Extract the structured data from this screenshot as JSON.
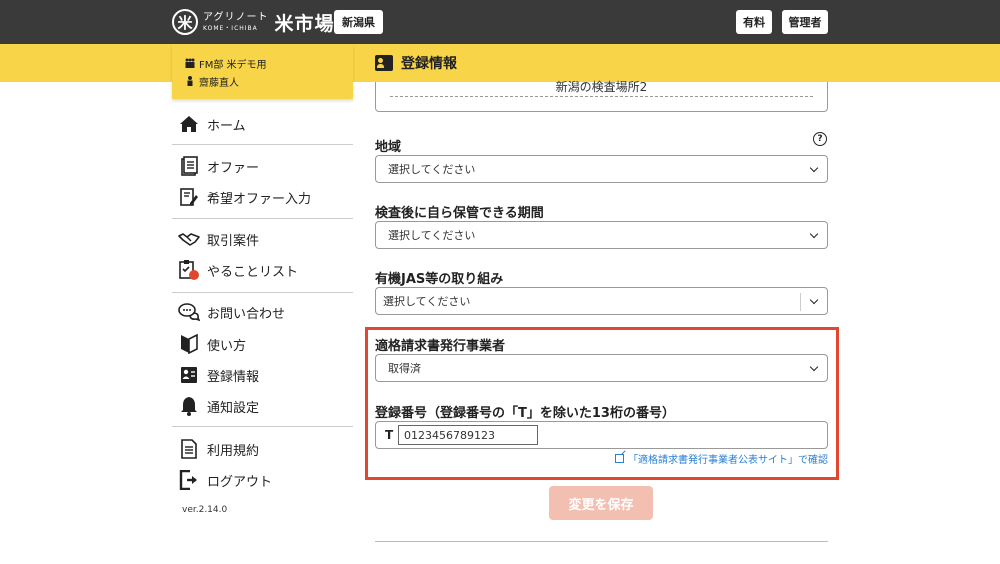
{
  "header": {
    "logo_mark": "米",
    "logo_jp": "アグリノート",
    "logo_en": "KOME・ICHIBA",
    "logo_big": "米市場",
    "region": "新潟県",
    "plan": "有料",
    "admin": "管理者"
  },
  "user": {
    "org": "FM部 米デモ用",
    "name": "齋藤直人"
  },
  "sidebar": {
    "items": [
      {
        "label": "ホーム",
        "icon": "home-icon"
      },
      {
        "label": "オファー",
        "icon": "offer-icon"
      },
      {
        "label": "希望オファー入力",
        "icon": "edit-document-icon"
      },
      {
        "label": "取引案件",
        "icon": "handshake-icon"
      },
      {
        "label": "やることリスト",
        "icon": "checklist-icon"
      },
      {
        "label": "お問い合わせ",
        "icon": "chat-icon"
      },
      {
        "label": "使い方",
        "icon": "beginner-mark-icon"
      },
      {
        "label": "登録情報",
        "icon": "id-card-icon"
      },
      {
        "label": "通知設定",
        "icon": "bell-icon"
      },
      {
        "label": "利用規約",
        "icon": "terms-icon"
      },
      {
        "label": "ログアウト",
        "icon": "logout-icon"
      }
    ],
    "version": "ver.2.14.0"
  },
  "main": {
    "section_title": "登録情報",
    "partial_text": "新潟の検査場所2",
    "region_label": "地域",
    "region_value": "選択してください",
    "storage_label": "検査後に自ら保管できる期間",
    "storage_value": "選択してください",
    "jas_label": "有機JAS等の取り組み",
    "jas_value": "選択してください",
    "invoice_label": "適格請求書発行事業者",
    "invoice_value": "取得済",
    "regnum_label": "登録番号（登録番号の「T」を除いた13桁の番号）",
    "regnum_prefix": "T",
    "regnum_value": "0123456789123",
    "confirm_link": "「適格請求書発行事業者公表サイト」で確認",
    "save_button": "変更を保存"
  },
  "colors": {
    "header_bg": "#3a3a3a",
    "accent_yellow": "#f8d548",
    "highlight_red": "#e0472e",
    "save_button_bg": "#f3bfb1",
    "link_blue": "#2a7fd4"
  }
}
